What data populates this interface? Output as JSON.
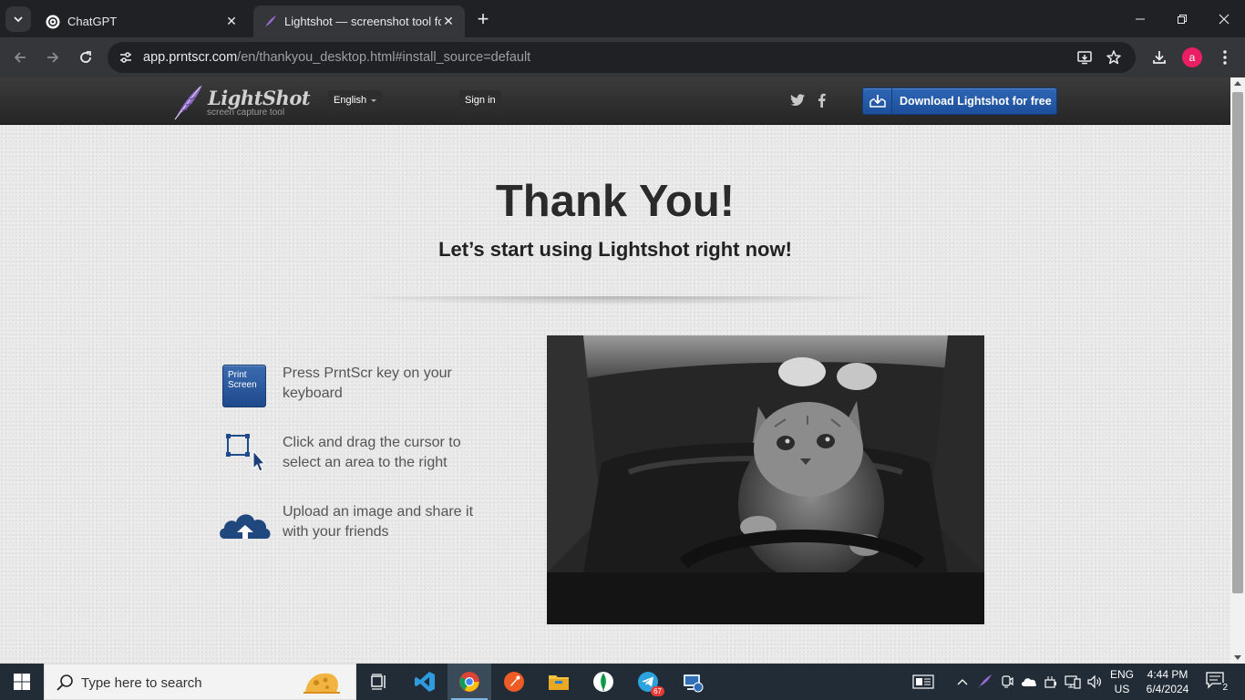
{
  "browser": {
    "tabs": [
      {
        "title": "ChatGPT",
        "active": false
      },
      {
        "title": "Lightshot — screenshot tool for",
        "active": true
      }
    ],
    "url_host": "app.prntscr.com",
    "url_path": "/en/thankyou_desktop.html#install_source=default",
    "profile_initial": "a"
  },
  "site_header": {
    "logo_name": "LightShot",
    "logo_subtitle": "screen capture tool",
    "language": "English",
    "signin": "Sign in",
    "download_button": "Download Lightshot for free"
  },
  "main": {
    "title": "Thank You!",
    "subtitle": "Let’s start using Lightshot right now!",
    "key_label_line1": "Print",
    "key_label_line2": "Screen",
    "steps": [
      {
        "icon": "print-screen-key-icon",
        "text": "Press PrntScr key on your keyboard"
      },
      {
        "icon": "select-area-icon",
        "text": "Click and drag the cursor to select an area to the right"
      },
      {
        "icon": "cloud-upload-icon",
        "text": "Upload an image and share it with your friends"
      }
    ]
  },
  "taskbar": {
    "search_placeholder": "Type here to search",
    "language": "ENG",
    "region": "US",
    "time": "4:44 PM",
    "date": "6/4/2024",
    "notification_count": "2",
    "telegram_badge": "67"
  },
  "colors": {
    "accent_blue": "#1d4f9a",
    "header_dark": "#2b2b2b",
    "page_bg": "#e9e9e9",
    "taskbar_bg": "#212c36"
  }
}
